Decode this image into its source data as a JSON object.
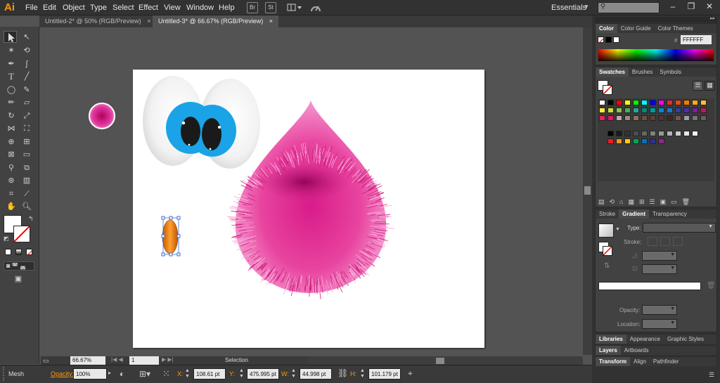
{
  "app": {
    "logo": "Ai",
    "workspace": "Essentials"
  },
  "menu": [
    "File",
    "Edit",
    "Object",
    "Type",
    "Select",
    "Effect",
    "View",
    "Window",
    "Help"
  ],
  "menu_buttons": [
    "Br",
    "St"
  ],
  "tabs": [
    {
      "label": "Untitled-2* @ 50% (RGB/Preview)",
      "active": false
    },
    {
      "label": "Untitled-3* @ 66.67% (RGB/Preview)",
      "active": true
    }
  ],
  "tab_close": "×",
  "status": {
    "zoom": "66.67%",
    "page": "1",
    "tool": "Selection"
  },
  "control": {
    "mode": "Mesh",
    "opacity_label": "Opacity:",
    "opacity_value": "100%",
    "x_label": "X:",
    "x_value": "108.61 pt",
    "y_label": "Y:",
    "y_value": "475.995 pt",
    "w_label": "W:",
    "w_value": "44.998 pt",
    "h_label": "H:",
    "h_value": "101.179 pt"
  },
  "color_panel": {
    "tabs": [
      "Color",
      "Color Guide",
      "Color Themes"
    ],
    "hex_label": "#",
    "hex_value": "FFFFFF"
  },
  "swatches_panel": {
    "tabs": [
      "Swatches",
      "Brushes",
      "Symbols"
    ]
  },
  "gradient_panel": {
    "tabs": [
      "Stroke",
      "Gradient",
      "Transparency"
    ],
    "type_label": "Type:",
    "stroke_label": "Stroke:",
    "opacity_label": "Opacity:",
    "location_label": "Location:"
  },
  "bottom_tabs": [
    [
      "Libraries",
      "Appearance",
      "Graphic Styles"
    ],
    [
      "Layers",
      "Artboards"
    ],
    [
      "Transform",
      "Align",
      "Pathfinder"
    ]
  ],
  "colors": {
    "accent_orange": "#ff9a00",
    "fur_pink": "#e0389f",
    "eye_blue": "#1aa3e6"
  },
  "swatch_rows": [
    [
      "#ffffff",
      "#000000",
      "#ff0000",
      "#ffff00",
      "#00ff00",
      "#00ffff",
      "#0000ff",
      "#ff00ff",
      "#e52a2a",
      "#e64a19",
      "#f57c00",
      "#f9a825",
      "#fbc02d"
    ],
    [
      "#ffeb3b",
      "#cddc39",
      "#8bc34a",
      "#4caf50",
      "#26a69a",
      "#00897b",
      "#0097a7",
      "#0288d1",
      "#1976d2",
      "#303f9f",
      "#512da8",
      "#7b1fa2",
      "#c2185b"
    ],
    [
      "#e91e63",
      "#d81b60",
      "#bcaaa4",
      "#a1887f",
      "#8d6e63",
      "#6d4c41",
      "#5d4037",
      "#4e342e",
      "#3e2723",
      "#795548",
      "#9e9e9e",
      "#757575",
      "#616161"
    ]
  ],
  "gray_row": [
    "#000000",
    "#1a1a1a",
    "#333333",
    "#4d4d4d",
    "#666666",
    "#808080",
    "#999999",
    "#b3b3b3",
    "#cccccc",
    "#e6e6e6",
    "#f2f2f2"
  ],
  "bright_row": [
    "#ed1c24",
    "#f7941d",
    "#ffcb05",
    "#00a651",
    "#0072bc",
    "#2e3192",
    "#92278f"
  ]
}
